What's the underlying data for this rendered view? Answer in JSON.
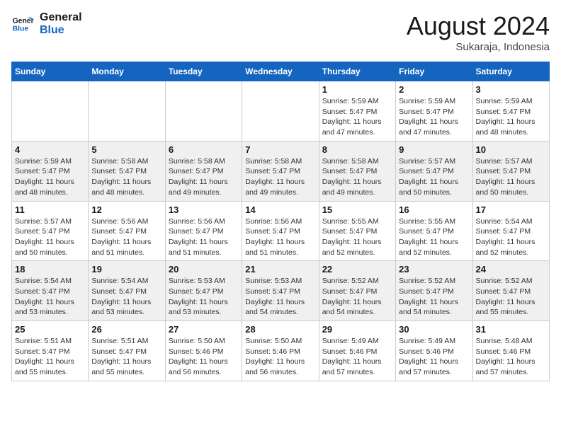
{
  "header": {
    "logo_line1": "General",
    "logo_line2": "Blue",
    "month_title": "August 2024",
    "subtitle": "Sukaraja, Indonesia"
  },
  "weekdays": [
    "Sunday",
    "Monday",
    "Tuesday",
    "Wednesday",
    "Thursday",
    "Friday",
    "Saturday"
  ],
  "weeks": [
    [
      {
        "day": "",
        "info": ""
      },
      {
        "day": "",
        "info": ""
      },
      {
        "day": "",
        "info": ""
      },
      {
        "day": "",
        "info": ""
      },
      {
        "day": "1",
        "info": "Sunrise: 5:59 AM\nSunset: 5:47 PM\nDaylight: 11 hours\nand 47 minutes."
      },
      {
        "day": "2",
        "info": "Sunrise: 5:59 AM\nSunset: 5:47 PM\nDaylight: 11 hours\nand 47 minutes."
      },
      {
        "day": "3",
        "info": "Sunrise: 5:59 AM\nSunset: 5:47 PM\nDaylight: 11 hours\nand 48 minutes."
      }
    ],
    [
      {
        "day": "4",
        "info": "Sunrise: 5:59 AM\nSunset: 5:47 PM\nDaylight: 11 hours\nand 48 minutes."
      },
      {
        "day": "5",
        "info": "Sunrise: 5:58 AM\nSunset: 5:47 PM\nDaylight: 11 hours\nand 48 minutes."
      },
      {
        "day": "6",
        "info": "Sunrise: 5:58 AM\nSunset: 5:47 PM\nDaylight: 11 hours\nand 49 minutes."
      },
      {
        "day": "7",
        "info": "Sunrise: 5:58 AM\nSunset: 5:47 PM\nDaylight: 11 hours\nand 49 minutes."
      },
      {
        "day": "8",
        "info": "Sunrise: 5:58 AM\nSunset: 5:47 PM\nDaylight: 11 hours\nand 49 minutes."
      },
      {
        "day": "9",
        "info": "Sunrise: 5:57 AM\nSunset: 5:47 PM\nDaylight: 11 hours\nand 50 minutes."
      },
      {
        "day": "10",
        "info": "Sunrise: 5:57 AM\nSunset: 5:47 PM\nDaylight: 11 hours\nand 50 minutes."
      }
    ],
    [
      {
        "day": "11",
        "info": "Sunrise: 5:57 AM\nSunset: 5:47 PM\nDaylight: 11 hours\nand 50 minutes."
      },
      {
        "day": "12",
        "info": "Sunrise: 5:56 AM\nSunset: 5:47 PM\nDaylight: 11 hours\nand 51 minutes."
      },
      {
        "day": "13",
        "info": "Sunrise: 5:56 AM\nSunset: 5:47 PM\nDaylight: 11 hours\nand 51 minutes."
      },
      {
        "day": "14",
        "info": "Sunrise: 5:56 AM\nSunset: 5:47 PM\nDaylight: 11 hours\nand 51 minutes."
      },
      {
        "day": "15",
        "info": "Sunrise: 5:55 AM\nSunset: 5:47 PM\nDaylight: 11 hours\nand 52 minutes."
      },
      {
        "day": "16",
        "info": "Sunrise: 5:55 AM\nSunset: 5:47 PM\nDaylight: 11 hours\nand 52 minutes."
      },
      {
        "day": "17",
        "info": "Sunrise: 5:54 AM\nSunset: 5:47 PM\nDaylight: 11 hours\nand 52 minutes."
      }
    ],
    [
      {
        "day": "18",
        "info": "Sunrise: 5:54 AM\nSunset: 5:47 PM\nDaylight: 11 hours\nand 53 minutes."
      },
      {
        "day": "19",
        "info": "Sunrise: 5:54 AM\nSunset: 5:47 PM\nDaylight: 11 hours\nand 53 minutes."
      },
      {
        "day": "20",
        "info": "Sunrise: 5:53 AM\nSunset: 5:47 PM\nDaylight: 11 hours\nand 53 minutes."
      },
      {
        "day": "21",
        "info": "Sunrise: 5:53 AM\nSunset: 5:47 PM\nDaylight: 11 hours\nand 54 minutes."
      },
      {
        "day": "22",
        "info": "Sunrise: 5:52 AM\nSunset: 5:47 PM\nDaylight: 11 hours\nand 54 minutes."
      },
      {
        "day": "23",
        "info": "Sunrise: 5:52 AM\nSunset: 5:47 PM\nDaylight: 11 hours\nand 54 minutes."
      },
      {
        "day": "24",
        "info": "Sunrise: 5:52 AM\nSunset: 5:47 PM\nDaylight: 11 hours\nand 55 minutes."
      }
    ],
    [
      {
        "day": "25",
        "info": "Sunrise: 5:51 AM\nSunset: 5:47 PM\nDaylight: 11 hours\nand 55 minutes."
      },
      {
        "day": "26",
        "info": "Sunrise: 5:51 AM\nSunset: 5:47 PM\nDaylight: 11 hours\nand 55 minutes."
      },
      {
        "day": "27",
        "info": "Sunrise: 5:50 AM\nSunset: 5:46 PM\nDaylight: 11 hours\nand 56 minutes."
      },
      {
        "day": "28",
        "info": "Sunrise: 5:50 AM\nSunset: 5:46 PM\nDaylight: 11 hours\nand 56 minutes."
      },
      {
        "day": "29",
        "info": "Sunrise: 5:49 AM\nSunset: 5:46 PM\nDaylight: 11 hours\nand 57 minutes."
      },
      {
        "day": "30",
        "info": "Sunrise: 5:49 AM\nSunset: 5:46 PM\nDaylight: 11 hours\nand 57 minutes."
      },
      {
        "day": "31",
        "info": "Sunrise: 5:48 AM\nSunset: 5:46 PM\nDaylight: 11 hours\nand 57 minutes."
      }
    ]
  ]
}
